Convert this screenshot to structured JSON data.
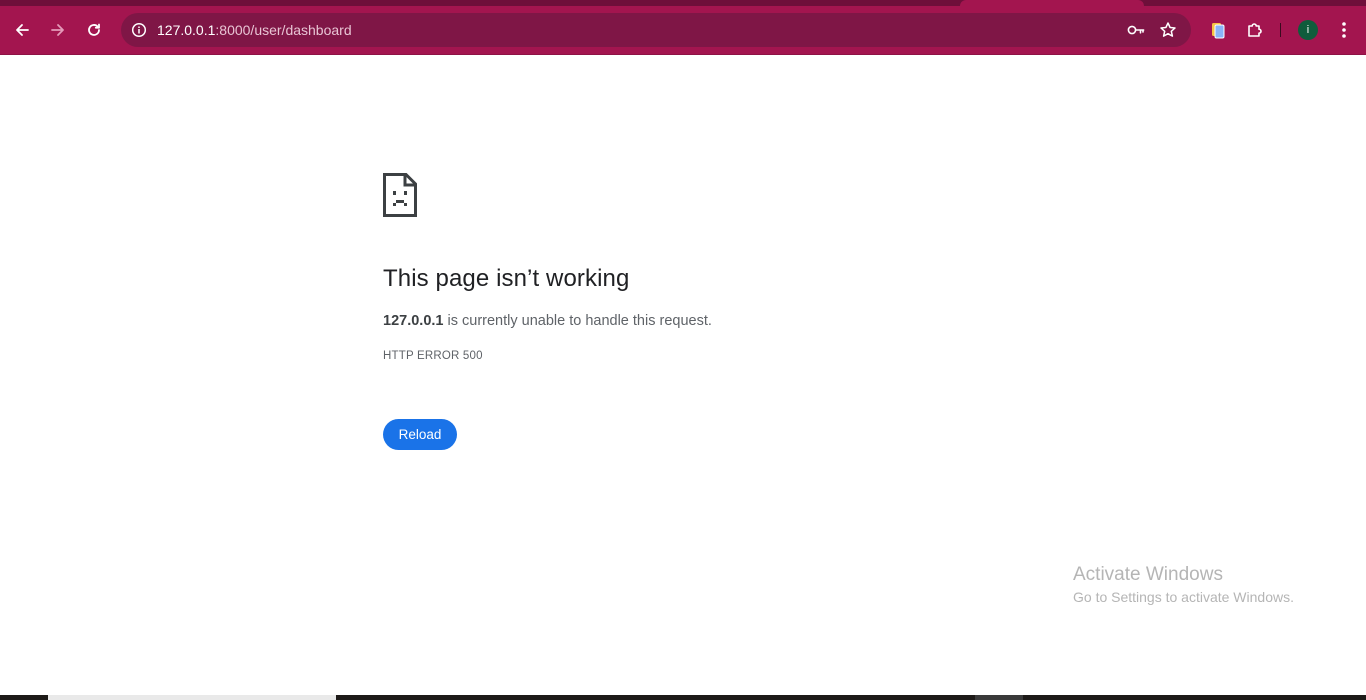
{
  "browser": {
    "address_bar": {
      "host": "127.0.0.1",
      "rest": ":8000/user/dashboard"
    },
    "profile_initial": "i",
    "theme_color": "#a3154f"
  },
  "icons": {
    "back": "back-arrow-icon",
    "forward": "forward-arrow-icon",
    "reload": "reload-icon",
    "site_info": "site-info-icon",
    "passwords": "key-icon",
    "bookmark": "star-icon",
    "reading_list": "side-panel-icon",
    "extensions": "puzzle-icon",
    "menu": "kebab-menu-icon",
    "error": "sad-document-icon"
  },
  "error_page": {
    "heading": "This page isn’t working",
    "host": "127.0.0.1",
    "message_suffix": " is currently unable to handle this request.",
    "error_code": "HTTP ERROR 500",
    "reload_label": "Reload",
    "button_color": "#1a73e8"
  },
  "watermark": {
    "line1": "Activate Windows",
    "line2": "Go to Settings to activate Windows."
  }
}
